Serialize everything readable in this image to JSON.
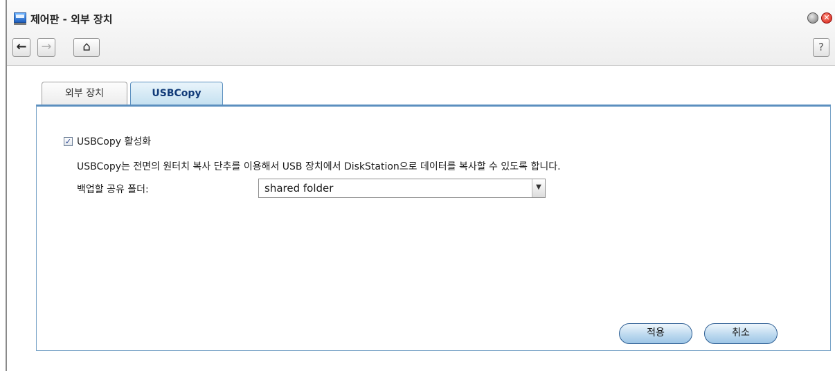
{
  "window": {
    "title": "제어판 - 외부 장치",
    "close_glyph": "✕"
  },
  "nav": {
    "back_icon": "←",
    "forward_icon": "→",
    "home_icon": "⌂",
    "help_label": "?"
  },
  "tabs": [
    {
      "label": "외부 장치",
      "active": false
    },
    {
      "label": "USBCopy",
      "active": true
    }
  ],
  "usbcopy": {
    "enable_checked": true,
    "check_glyph": "✓",
    "enable_label": "USBCopy 활성화",
    "description": "USBCopy는 전면의 원터치 복사 단추를 이용해서 USB 장치에서 DiskStation으로 데이터를 복사할 수 있도록 합니다.",
    "folder_label": "백업할 공유 폴더:",
    "folder_value": "shared folder",
    "dropdown_icon": "▼"
  },
  "buttons": {
    "apply": "적용",
    "cancel": "취소"
  },
  "colors": {
    "tab_active": "#c4e0f0",
    "panel_border": "#5b8fbf",
    "button_fill": "#b9d7ee"
  }
}
